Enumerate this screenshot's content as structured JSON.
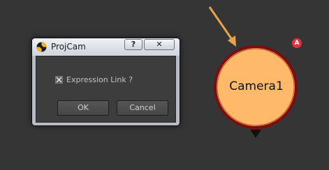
{
  "dialog": {
    "title": "ProjCam",
    "help_label": "?",
    "close_label": "✕",
    "checkbox_label": "Expression Link ?",
    "checkbox_checked": true,
    "ok_label": "OK",
    "cancel_label": "Cancel"
  },
  "node": {
    "label": "Camera1",
    "badge": "A",
    "fill_color": "#ffb96b",
    "border_color": "#7a0d0d",
    "badge_color": "#e0323c",
    "arrow_color": "#e8a24a"
  },
  "icons": {
    "app": "nuke-app-icon",
    "help": "help-icon",
    "close": "close-icon",
    "check": "check-icon"
  }
}
